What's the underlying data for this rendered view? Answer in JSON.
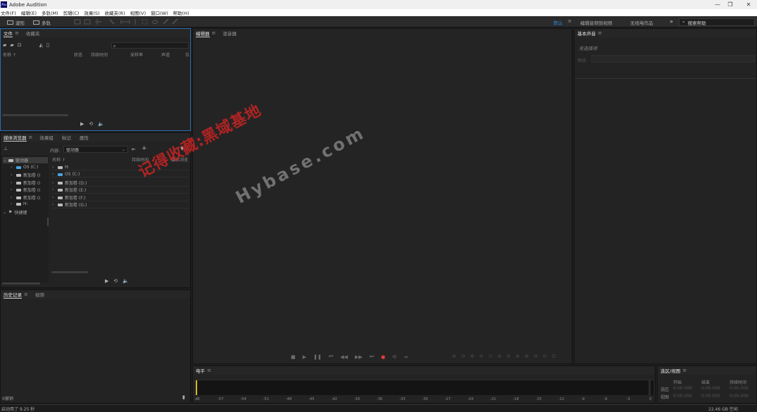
{
  "window": {
    "app_icon": "Au",
    "title": "Adobe Audition",
    "minimize": "—",
    "restore": "❐",
    "close": "✕"
  },
  "menu": [
    "文件(F)",
    "编辑(E)",
    "多轨(M)",
    "剪辑(C)",
    "效果(S)",
    "收藏夹(R)",
    "视图(V)",
    "窗口(W)",
    "帮助(H)"
  ],
  "toolbar": {
    "waveform_label": "波形",
    "multitrack_label": "多轨",
    "workspace_default": "默认",
    "workspace_edit_video": "编辑音频到视频",
    "workspace_untitled": "无线电作品",
    "overflow": "»",
    "search_placeholder": "搜索帮助",
    "accent_color": "#2d8ceb"
  },
  "files_panel": {
    "tabs": [
      "文件",
      "收藏夹"
    ],
    "columns": [
      "名称 ↑",
      "状态",
      "持续时间",
      "采样率",
      "声道",
      "位"
    ]
  },
  "media_panel": {
    "tabs": [
      "媒体浏览器",
      "效果组",
      "标记",
      "属性"
    ],
    "content_label": "内容:",
    "content_value": "驱动器",
    "col_name": "名称 ↑",
    "col_duration": "持续时间",
    "col_media": "媒体浏览",
    "tree": [
      {
        "label": "驱动器",
        "type": "root"
      },
      {
        "label": "OS (C:)",
        "type": "os"
      },
      {
        "label": "新加卷 (D:)",
        "type": "drive"
      },
      {
        "label": "新加卷 (E:)",
        "type": "drive"
      },
      {
        "label": "新加卷 (F:)",
        "type": "drive"
      },
      {
        "label": "新加卷 (G:)",
        "type": "drive"
      },
      {
        "label": "H:",
        "type": "drive"
      },
      {
        "label": "快捷键",
        "type": "shortcut"
      }
    ],
    "tree_truncated": [
      "驱动器",
      "OS (C:)",
      "新加卷 (I",
      "新加卷 (I",
      "新加卷 (I",
      "新加卷 (I",
      "H:",
      "快捷键"
    ],
    "list": [
      "H:",
      "OS (C:)",
      "新加卷 (D:)",
      "新加卷 (E:)",
      "新加卷 (F:)",
      "新加卷 (G:)"
    ]
  },
  "history_panel": {
    "tabs": [
      "历史记录",
      "视频"
    ],
    "undo_label": "0撤销"
  },
  "editor_panel": {
    "tabs": [
      "编辑器",
      "混音器"
    ]
  },
  "essential_sound": {
    "title": "基本声音",
    "no_selection": "无选择项",
    "preset_label": "预设:"
  },
  "levels_panel": {
    "title": "电平",
    "ticks": [
      "dB",
      "-57",
      "-54",
      "-51",
      "-48",
      "-45",
      "-42",
      "-39",
      "-36",
      "-33",
      "-30",
      "-27",
      "-24",
      "-21",
      "-18",
      "-15",
      "-12",
      "-9",
      "-6",
      "-3",
      "0"
    ]
  },
  "selection_panel": {
    "title": "选区/视图",
    "col_start": "开始",
    "col_end": "结束",
    "col_duration": "持续时间",
    "row_selection": "选区",
    "row_view": "视图",
    "zero_time": "0:00.000"
  },
  "status": {
    "left": "启动用了 9.25 秒",
    "right": "22.46 GB 空闲"
  },
  "watermark": {
    "cn": "记得收藏:黑域基地",
    "en": "Hybase.com"
  }
}
